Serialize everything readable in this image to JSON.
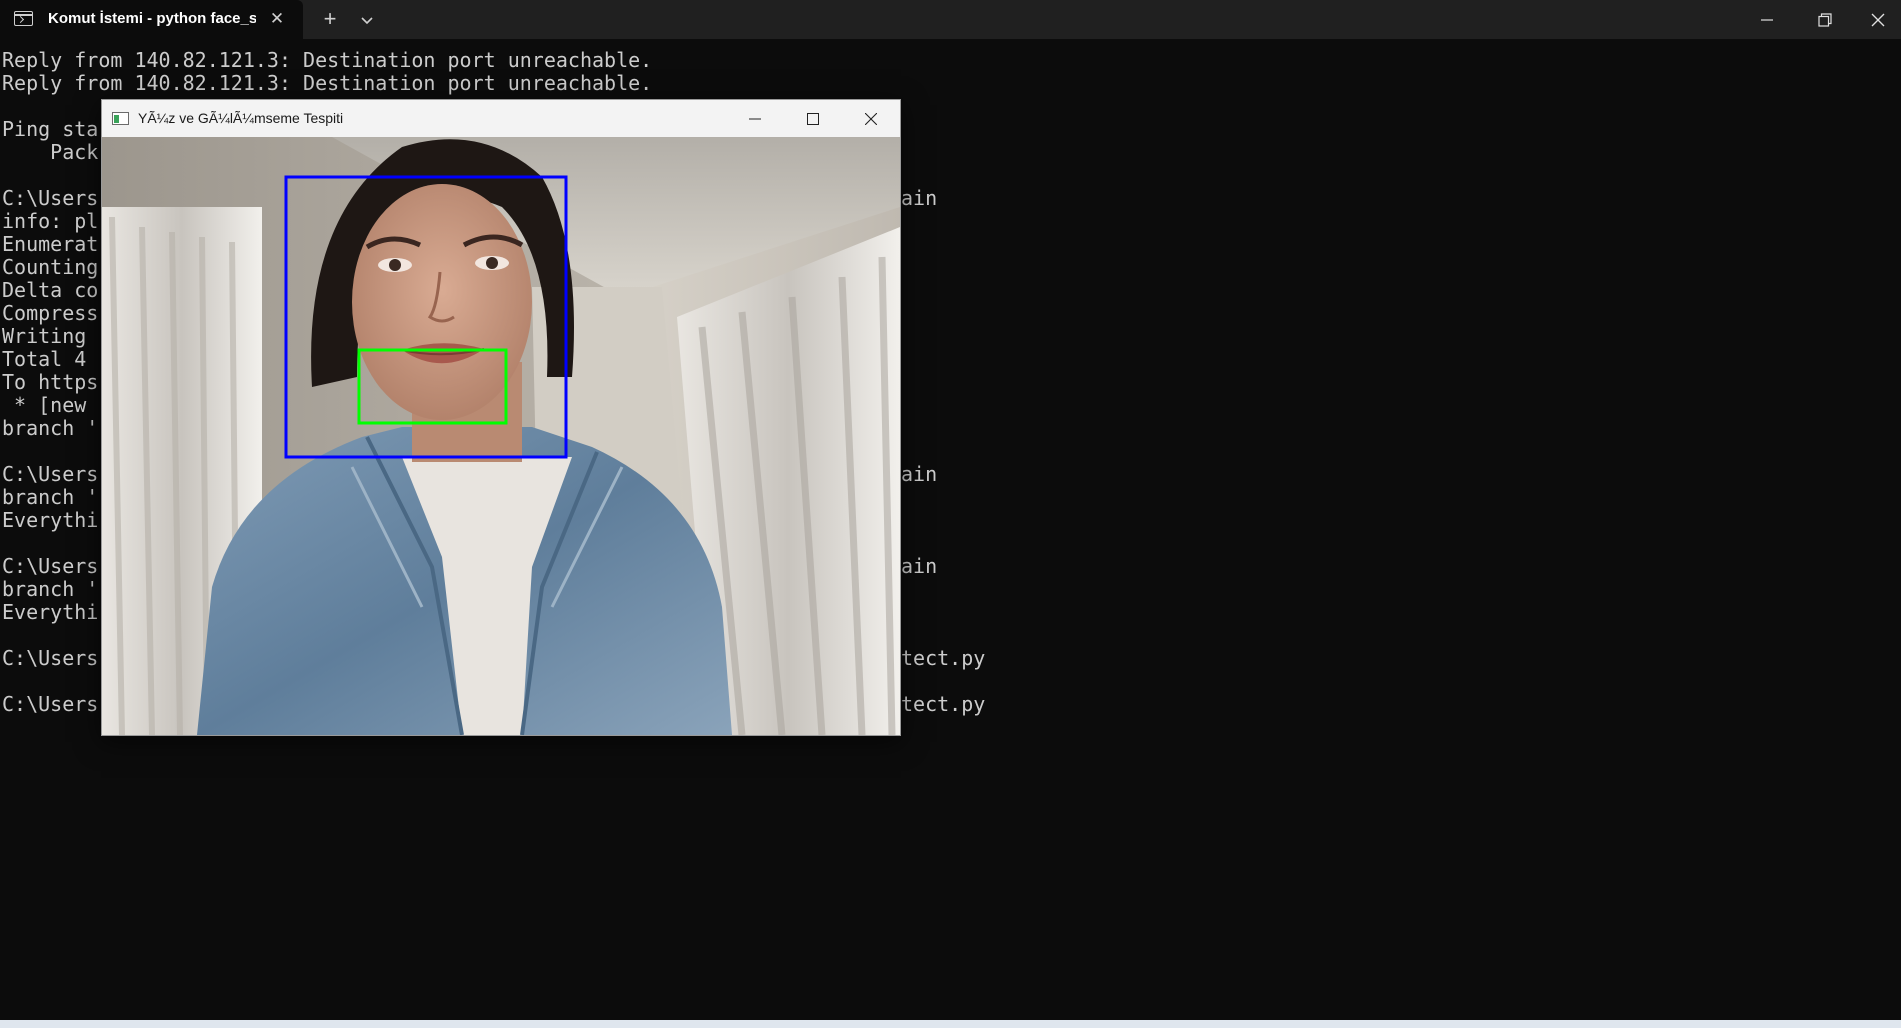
{
  "terminal": {
    "tab_title": "Komut İstemi - python  face_s",
    "tab_close_icon": "close-icon",
    "new_tab_icon": "plus-icon",
    "dropdown_icon": "chevron-down-icon",
    "window_controls": [
      "minimize-icon",
      "restore-icon",
      "close-icon"
    ]
  },
  "console": {
    "lines": [
      "Reply from 140.82.121.3: Destination port unreachable.",
      "Reply from 140.82.121.3: Destination port unreachable.",
      "",
      "Ping sta",
      "    Pack",
      "",
      "C:\\Users",
      "info: pl",
      "Enumerat",
      "Counting",
      "Delta co",
      "Compress",
      "Writing ",
      "Total 4 ",
      "To https",
      " * [new ",
      "branch '",
      "",
      "C:\\Users",
      "branch '",
      "Everythi",
      "",
      "C:\\Users",
      "branch '",
      "Everythi",
      "",
      "C:\\Users",
      "",
      "C:\\Users"
    ],
    "right_fragments": {
      "line7": "ain",
      "line19": "ain",
      "line23": "ain",
      "line27": "tect.py",
      "line29": "tect.py"
    }
  },
  "opencv_window": {
    "title": "YÃ¼z ve GÃ¼lÃ¼mseme Tespiti",
    "controls": [
      "minimize-icon",
      "maximize-icon",
      "close-icon"
    ],
    "face_box_color": "#0000ff",
    "smile_box_color": "#00ff00"
  }
}
